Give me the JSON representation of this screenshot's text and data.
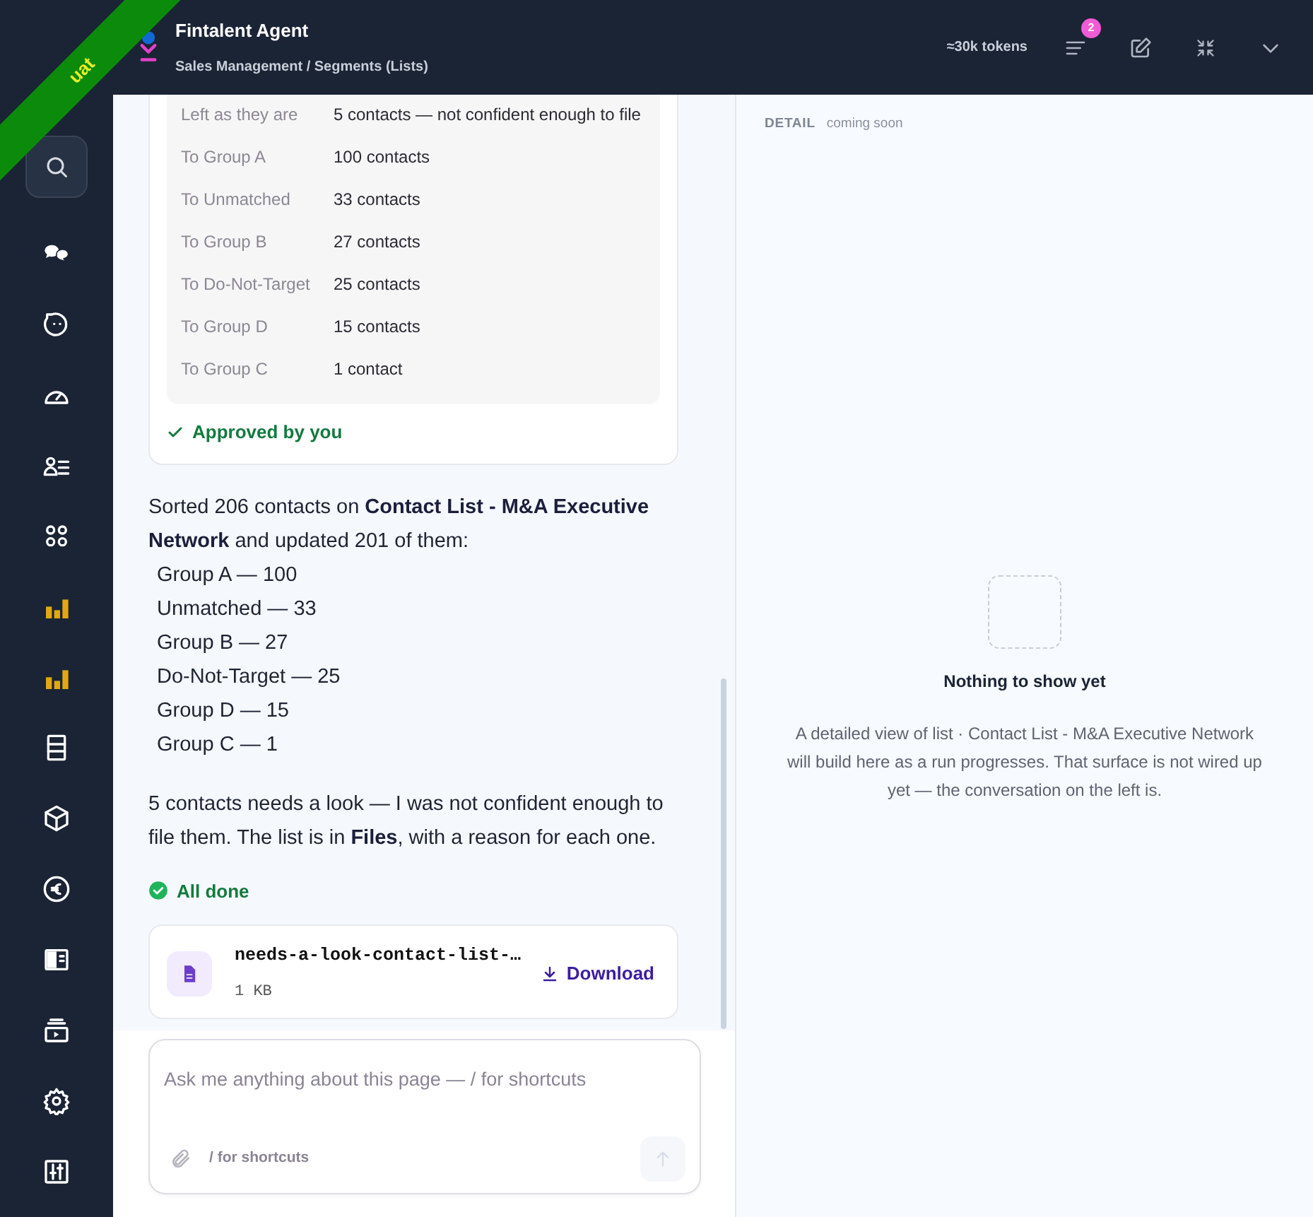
{
  "environment_ribbon": {
    "label": "uat"
  },
  "header": {
    "title": "Fintalent Agent",
    "breadcrumb": "Sales Management / Segments (Lists)",
    "tokens": "≈30k tokens",
    "list_badge": "2"
  },
  "summary": {
    "rows": [
      {
        "label": "Left as they are",
        "value": "5 contacts — not confident enough to file"
      },
      {
        "label": "To Group A",
        "value": "100 contacts"
      },
      {
        "label": "To Unmatched",
        "value": "33 contacts"
      },
      {
        "label": "To Group B",
        "value": "27 contacts"
      },
      {
        "label": "To Do-Not-Target",
        "value": "25 contacts"
      },
      {
        "label": "To Group D",
        "value": "15 contacts"
      },
      {
        "label": "To Group C",
        "value": "1 contact"
      }
    ],
    "approval": "Approved by you"
  },
  "message": {
    "intro": "Sorted 206 contacts on **Contact List - M&A Executive Network** and updated 201 of them:",
    "lines": [
      "Group A — 100",
      "Unmatched — 33",
      "Group B — 27",
      "Do-Not-Target — 25",
      "Group D — 15",
      "Group C — 1"
    ],
    "note": "5 contacts needs a look — I was not confident enough to file them. The list is in **Files**, with a reason for each one.",
    "status": "All done"
  },
  "file": {
    "name": "needs-a-look-contact-list-…",
    "size": "1 KB",
    "action": "Download"
  },
  "composer": {
    "placeholder": "Ask me anything about this page — / for shortcuts",
    "hint": "/ for shortcuts",
    "send_disabled": true
  },
  "detail": {
    "label": "DETAIL",
    "tag": "coming soon",
    "empty_title": "Nothing to show yet",
    "empty_text": "A detailed view of list · Contact List - M&A Executive Network will build here as a run progresses. That surface is not wired up yet — the conversation on the left is."
  }
}
